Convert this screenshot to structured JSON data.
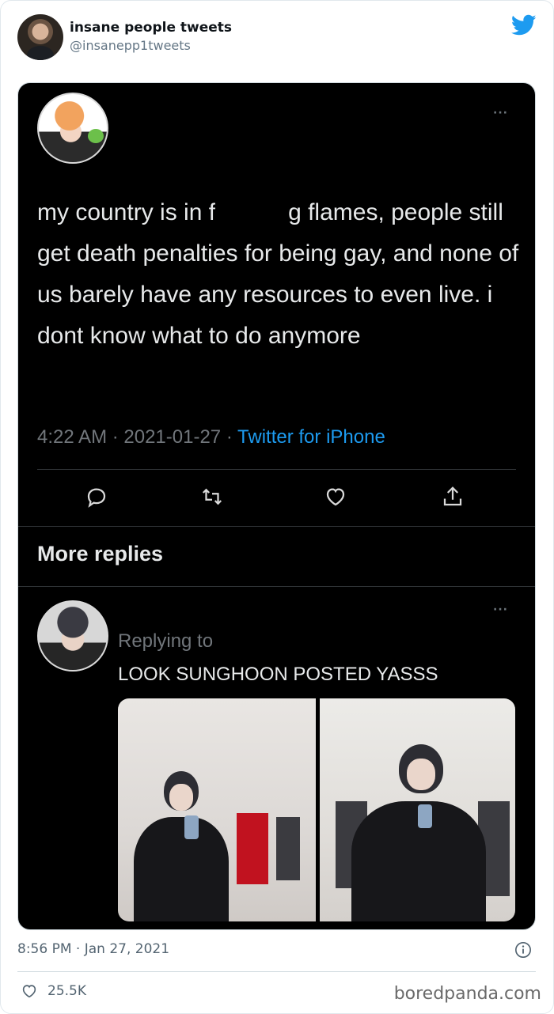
{
  "header": {
    "name": "insane people tweets",
    "handle": "@insanepp1tweets",
    "bird_icon": "twitter-bird-icon"
  },
  "inner_tweet": {
    "menu": "···",
    "text_parts": [
      "my country is in f",
      "g flames, people still get death penalties for being gay, and none of us barely have any resources to even live. i dont know what to do anymore"
    ],
    "meta_time": "4:22 AM · 2021-01-27 · ",
    "meta_source": "Twitter for iPhone",
    "actions": [
      "reply-icon",
      "retweet-icon",
      "like-icon",
      "share-icon"
    ]
  },
  "more_replies": "More replies",
  "reply": {
    "menu": "···",
    "replying_to": "Replying to",
    "text": "LOOK SUNGHOON POSTED YASSS"
  },
  "footer": {
    "timestamp": "8:56 PM · Jan 27, 2021",
    "likes": "25.5K",
    "watermark": "boredpanda.com"
  },
  "colors": {
    "twitter_blue": "#1d9bf0",
    "dark_bg": "#000000",
    "muted": "#71767b"
  }
}
